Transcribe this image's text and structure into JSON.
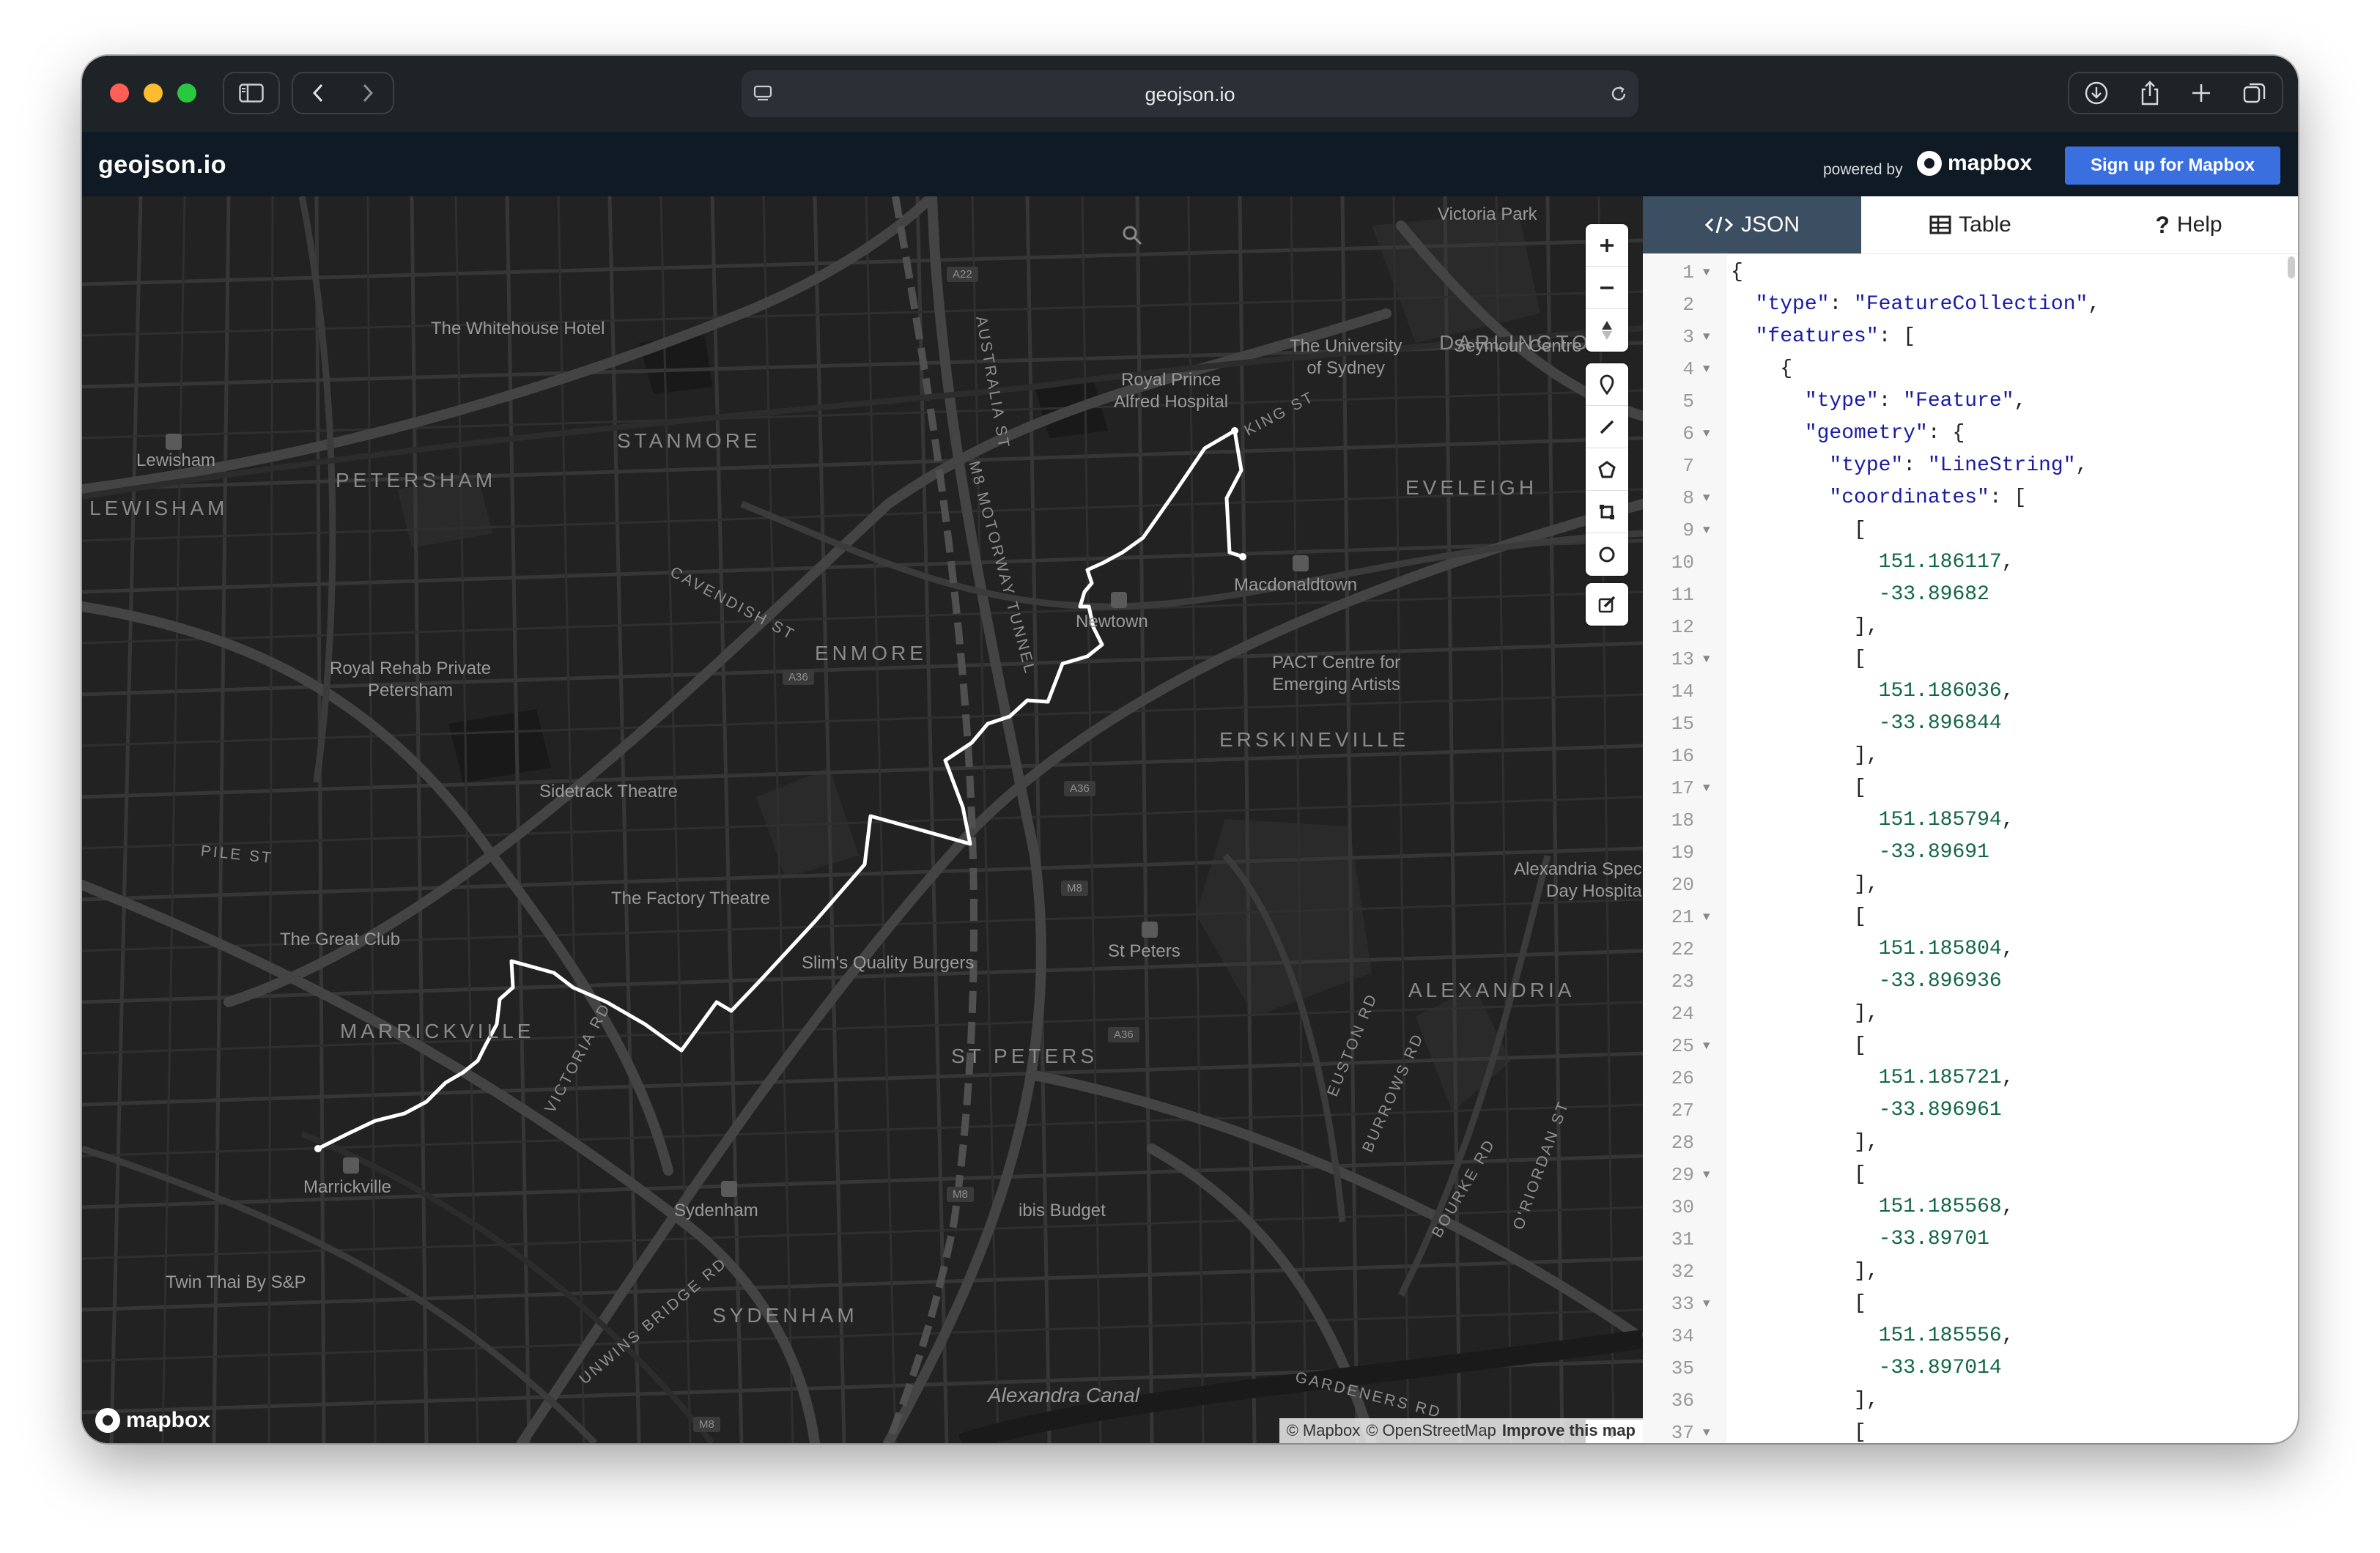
{
  "browser": {
    "url": "geojson.io"
  },
  "app": {
    "title": "geojson.io",
    "powered_by": "powered by",
    "mapbox_brand": "mapbox",
    "signup_label": "Sign up for Mapbox"
  },
  "map": {
    "areas": [
      "STANMORE",
      "PETERSHAM",
      "LEWISHAM",
      "ENMORE",
      "ERSKINEVILLE",
      "EVELEIGH",
      "DARLINGTON",
      "MARRICKVILLE",
      "ST PETERS",
      "ALEXANDRIA",
      "SYDENHAM"
    ],
    "places": [
      "The Whitehouse Hotel",
      "Lewisham",
      "Royal Prince\nAlfred Hospital",
      "The University\nof Sydney",
      "Seymour Centre",
      "Victoria Park",
      "Newtown",
      "Macdonaldtown",
      "PACT Centre for\nEmerging Artists",
      "Royal Rehab Private\nPetersham",
      "Sidetrack Theatre",
      "The Factory Theatre",
      "Slim's Quality Burgers",
      "St Peters",
      "Alexandria Spec\nDay Hospita",
      "The Great Club",
      "Marrickville",
      "Sydenham",
      "ibis Budget",
      "Twin Thai By S&P",
      "Alexandra Canal"
    ],
    "roads": [
      "AUSTRALIA ST",
      "M8 MOTORWAY TUNNEL",
      "CAVENDISH ST",
      "KING ST",
      "PILE ST",
      "VICTORIA RD",
      "EUSTON RD",
      "BURROWS RD",
      "BOURKE RD",
      "O'RIORDAN ST",
      "UNWINS BRIDGE RD",
      "GARDENERS RD"
    ],
    "shields": [
      "A22",
      "A36",
      "A36",
      "M8",
      "A36",
      "M8",
      "M8"
    ],
    "attribution": {
      "mapbox": "© Mapbox",
      "osm": "© OpenStreetMap",
      "improve": "Improve this map"
    },
    "logo": "mapbox",
    "route_color": "#ffffff"
  },
  "panel": {
    "tabs": [
      {
        "label": "JSON",
        "active": true,
        "icon": "code-icon"
      },
      {
        "label": "Table",
        "active": false,
        "icon": "table-icon"
      },
      {
        "label": "Help",
        "active": false,
        "icon": "help-icon"
      }
    ],
    "lines": [
      {
        "n": "1",
        "fold": true,
        "text": "{"
      },
      {
        "n": "2",
        "fold": false,
        "text": "  \"type\": \"FeatureCollection\","
      },
      {
        "n": "3",
        "fold": true,
        "text": "  \"features\": ["
      },
      {
        "n": "4",
        "fold": true,
        "text": "    {"
      },
      {
        "n": "5",
        "fold": false,
        "text": "      \"type\": \"Feature\","
      },
      {
        "n": "6",
        "fold": true,
        "text": "      \"geometry\": {"
      },
      {
        "n": "7",
        "fold": false,
        "text": "        \"type\": \"LineString\","
      },
      {
        "n": "8",
        "fold": true,
        "text": "        \"coordinates\": ["
      },
      {
        "n": "9",
        "fold": true,
        "text": "          ["
      },
      {
        "n": "10",
        "fold": false,
        "text": "            151.186117,"
      },
      {
        "n": "11",
        "fold": false,
        "text": "            -33.89682"
      },
      {
        "n": "12",
        "fold": false,
        "text": "          ],"
      },
      {
        "n": "13",
        "fold": true,
        "text": "          ["
      },
      {
        "n": "14",
        "fold": false,
        "text": "            151.186036,"
      },
      {
        "n": "15",
        "fold": false,
        "text": "            -33.896844"
      },
      {
        "n": "16",
        "fold": false,
        "text": "          ],"
      },
      {
        "n": "17",
        "fold": true,
        "text": "          ["
      },
      {
        "n": "18",
        "fold": false,
        "text": "            151.185794,"
      },
      {
        "n": "19",
        "fold": false,
        "text": "            -33.89691"
      },
      {
        "n": "20",
        "fold": false,
        "text": "          ],"
      },
      {
        "n": "21",
        "fold": true,
        "text": "          ["
      },
      {
        "n": "22",
        "fold": false,
        "text": "            151.185804,"
      },
      {
        "n": "23",
        "fold": false,
        "text": "            -33.896936"
      },
      {
        "n": "24",
        "fold": false,
        "text": "          ],"
      },
      {
        "n": "25",
        "fold": true,
        "text": "          ["
      },
      {
        "n": "26",
        "fold": false,
        "text": "            151.185721,"
      },
      {
        "n": "27",
        "fold": false,
        "text": "            -33.896961"
      },
      {
        "n": "28",
        "fold": false,
        "text": "          ],"
      },
      {
        "n": "29",
        "fold": true,
        "text": "          ["
      },
      {
        "n": "30",
        "fold": false,
        "text": "            151.185568,"
      },
      {
        "n": "31",
        "fold": false,
        "text": "            -33.89701"
      },
      {
        "n": "32",
        "fold": false,
        "text": "          ],"
      },
      {
        "n": "33",
        "fold": true,
        "text": "          ["
      },
      {
        "n": "34",
        "fold": false,
        "text": "            151.185556,"
      },
      {
        "n": "35",
        "fold": false,
        "text": "            -33.897014"
      },
      {
        "n": "36",
        "fold": false,
        "text": "          ],"
      },
      {
        "n": "37",
        "fold": true,
        "text": "          ["
      }
    ]
  }
}
